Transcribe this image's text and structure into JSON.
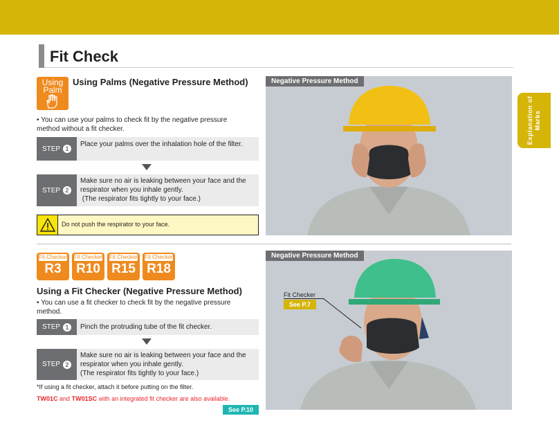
{
  "page": {
    "title": "Fit Check",
    "side_tab": "Explanation of Marks"
  },
  "palms": {
    "icon_text": "Using Palm",
    "heading": "Using Palms (Negative Pressure Method)",
    "bullet": "• You can use your palms to check fit by the negative pressure method without a fit checker.",
    "step_word": "STEP",
    "step1_num": "1",
    "step1_text": "Place your palms over the inhalation hole of the filter.",
    "step2_num": "2",
    "step2_text": "Make sure no air is leaking between your face and the respirator when you inhale gently.",
    "step2_text2": "(The respirator fits tightly to your face.)",
    "warning": "Do not push the respirator to your face.",
    "photo_label": "Negative Pressure Method"
  },
  "checker": {
    "badges": [
      {
        "small": "Fit Checker",
        "big": "R3"
      },
      {
        "small": "Fit Checker",
        "big": "R10"
      },
      {
        "small": "Fit Checker",
        "big": "R15"
      },
      {
        "small": "Fit Checker",
        "big": "R18"
      }
    ],
    "heading": "Using a Fit Checker (Negative Pressure Method)",
    "bullet": "• You can use a fit checker to check fit by the negative pressure method.",
    "step_word": "STEP",
    "step1_num": "1",
    "step1_text": "Pinch the protruding tube of the fit checker.",
    "step2_num": "2",
    "step2_text": "Make sure no air is leaking between your face and the respirator when you inhale gently.",
    "step2_text2": "(The respirator fits tightly to your face.)",
    "note": "*If using a fit checker, attach it before putting on the filter.",
    "model1": "TW01C",
    "and_word": "and",
    "model2": "TW01SC",
    "model_suffix": "with an integrated fit checker are also available.",
    "see_p10": "See P.10",
    "photo_label": "Negative Pressure Method",
    "callout": "Fit Checker",
    "see_p7": "See P.7"
  },
  "colors": {
    "band_gold": "#d6b509",
    "orange": "#ef8a1e",
    "step_gray": "#6d6e71",
    "teal": "#1fb6b2",
    "red": "#e8262c",
    "helmet_yellow": "#f2c014",
    "helmet_green": "#3fbf8c"
  }
}
